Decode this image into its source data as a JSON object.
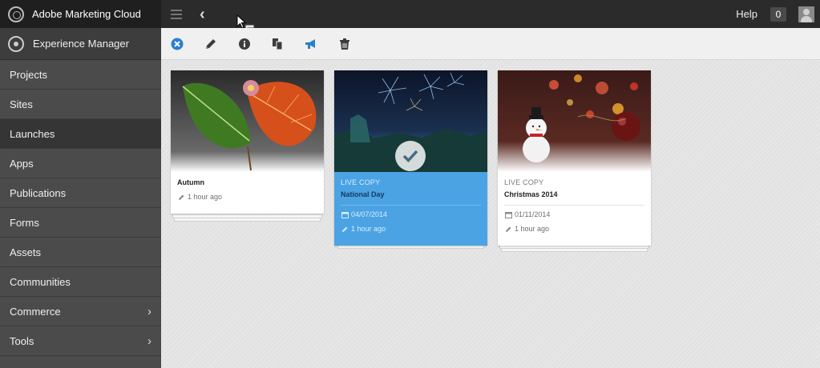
{
  "app": {
    "brand": "Adobe Marketing Cloud",
    "product": "Experience Manager"
  },
  "sidebar": {
    "items": [
      {
        "label": "Projects",
        "has_children": false,
        "active": false
      },
      {
        "label": "Sites",
        "has_children": false,
        "active": false
      },
      {
        "label": "Launches",
        "has_children": false,
        "active": true
      },
      {
        "label": "Apps",
        "has_children": false,
        "active": false
      },
      {
        "label": "Publications",
        "has_children": false,
        "active": false
      },
      {
        "label": "Forms",
        "has_children": false,
        "active": false
      },
      {
        "label": "Assets",
        "has_children": false,
        "active": false
      },
      {
        "label": "Communities",
        "has_children": false,
        "active": false
      },
      {
        "label": "Commerce",
        "has_children": true,
        "active": false
      },
      {
        "label": "Tools",
        "has_children": true,
        "active": false
      }
    ]
  },
  "topbar": {
    "help_label": "Help",
    "notification_count": "0"
  },
  "actionbar": {
    "icons": [
      "close-selection-icon",
      "edit-icon",
      "info-icon",
      "copy-icon",
      "promote-icon",
      "delete-icon"
    ]
  },
  "cards": [
    {
      "type": "",
      "title": "Autumn",
      "date": "",
      "modified": "1 hour ago",
      "selected": false
    },
    {
      "type": "LIVE COPY",
      "title": "National Day",
      "date": "04/07/2014",
      "modified": "1 hour ago",
      "selected": true
    },
    {
      "type": "LIVE COPY",
      "title": "Christmas 2014",
      "date": "01/11/2014",
      "modified": "1 hour ago",
      "selected": false
    }
  ],
  "colors": {
    "sidebar": "#4b4b4b",
    "topbar": "#2b2b2b",
    "selected_card": "#4ba3e3",
    "action_icon": "#3c3c3c",
    "accent_blue": "#2a7fcf"
  }
}
